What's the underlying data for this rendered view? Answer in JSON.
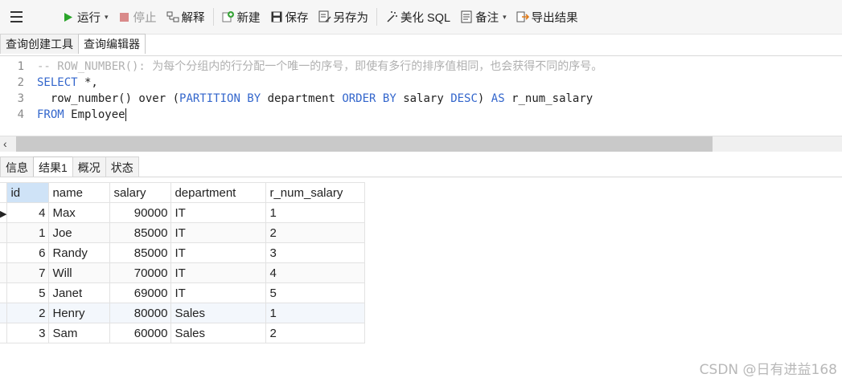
{
  "toolbar": {
    "run": "运行",
    "stop": "停止",
    "explain": "解释",
    "new": "新建",
    "save": "保存",
    "save_as": "另存为",
    "beautify": "美化 SQL",
    "notes": "备注",
    "export": "导出结果"
  },
  "top_tabs": [
    "查询创建工具",
    "查询编辑器"
  ],
  "editor": {
    "line_numbers": [
      "1",
      "2",
      "3",
      "4"
    ],
    "l1_comment": "-- ROW_NUMBER(): 为每个分组内的行分配一个唯一的序号，即使有多行的排序值相同，也会获得不同的序号。",
    "l2_kw": "SELECT",
    "l2_rest": " *,",
    "l3_a": "  row_number() over (",
    "l3_kw1": "PARTITION BY",
    "l3_b": " department ",
    "l3_kw2": "ORDER BY",
    "l3_c": " salary ",
    "l3_kw3": "DESC",
    "l3_d": ") ",
    "l3_kw4": "AS",
    "l3_e": " r_num_salary",
    "l4_kw": "FROM",
    "l4_rest": " Employee"
  },
  "bottom_tabs": [
    "信息",
    "结果1",
    "概况",
    "状态"
  ],
  "grid": {
    "columns": [
      "id",
      "name",
      "salary",
      "department",
      "r_num_salary"
    ],
    "rows": [
      [
        "4",
        "Max",
        "90000",
        "IT",
        "1"
      ],
      [
        "1",
        "Joe",
        "85000",
        "IT",
        "2"
      ],
      [
        "6",
        "Randy",
        "85000",
        "IT",
        "3"
      ],
      [
        "7",
        "Will",
        "70000",
        "IT",
        "4"
      ],
      [
        "5",
        "Janet",
        "69000",
        "IT",
        "5"
      ],
      [
        "2",
        "Henry",
        "80000",
        "Sales",
        "1"
      ],
      [
        "3",
        "Sam",
        "60000",
        "Sales",
        "2"
      ]
    ]
  },
  "watermark": "CSDN @日有进益168"
}
